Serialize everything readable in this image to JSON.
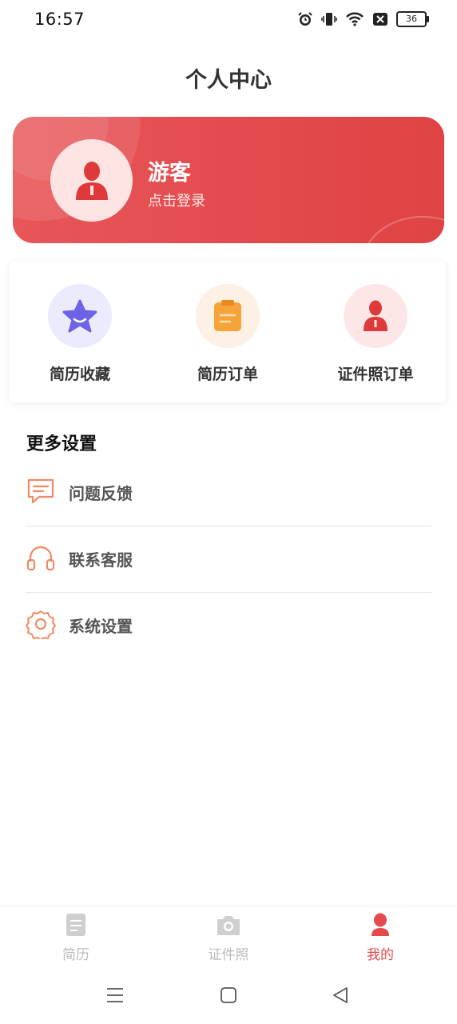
{
  "status_bar": {
    "time": "16:57",
    "battery": "36"
  },
  "header": {
    "title": "个人中心"
  },
  "profile": {
    "name": "游客",
    "login_prompt": "点击登录"
  },
  "quick_actions": [
    {
      "label": "简历收藏",
      "icon": "star-icon"
    },
    {
      "label": "简历订单",
      "icon": "clipboard-icon"
    },
    {
      "label": "证件照订单",
      "icon": "person-icon"
    }
  ],
  "settings": {
    "section_title": "更多设置",
    "items": [
      {
        "label": "问题反馈",
        "icon": "message-icon"
      },
      {
        "label": "联系客服",
        "icon": "headset-icon"
      },
      {
        "label": "系统设置",
        "icon": "gear-icon"
      }
    ]
  },
  "bottom_nav": {
    "items": [
      {
        "label": "简历",
        "icon": "document-icon",
        "active": false
      },
      {
        "label": "证件照",
        "icon": "camera-icon",
        "active": false
      },
      {
        "label": "我的",
        "icon": "user-icon",
        "active": true
      }
    ]
  },
  "colors": {
    "accent": "#e34a4c",
    "icon_orange": "#f0906a",
    "inactive": "#bbbbbb"
  }
}
